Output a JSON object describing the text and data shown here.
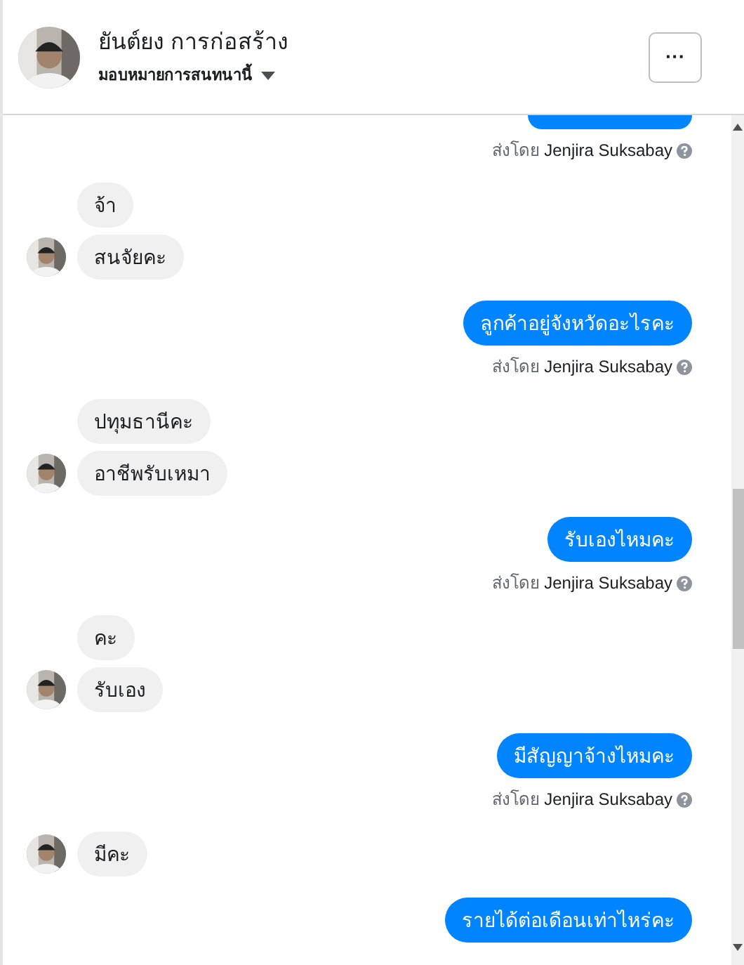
{
  "header": {
    "name": "ยันต์ยง การก่อสร้าง",
    "assign_label": "มอบหมายการสนทนานี้",
    "more_button": "···"
  },
  "messages": [
    {
      "kind": "outgoing_cut",
      "sent_by_label": "ส่งโดย",
      "sender": "Jenjira Suksabay"
    },
    {
      "kind": "incoming",
      "bubbles": [
        "จ้า",
        "สนจัยคะ"
      ]
    },
    {
      "kind": "outgoing",
      "text": "ลูกค้าอยู่จังหวัดอะไรคะ",
      "sent_by_label": "ส่งโดย",
      "sender": "Jenjira Suksabay"
    },
    {
      "kind": "incoming",
      "bubbles": [
        "ปทุมธานีคะ",
        "อาชีพรับเหมา"
      ]
    },
    {
      "kind": "outgoing",
      "text": "รับเองไหมคะ",
      "sent_by_label": "ส่งโดย",
      "sender": "Jenjira Suksabay"
    },
    {
      "kind": "incoming",
      "bubbles": [
        "คะ",
        "รับเอง"
      ]
    },
    {
      "kind": "outgoing",
      "text": "มีสัญญาจ้างไหมคะ",
      "sent_by_label": "ส่งโดย",
      "sender": "Jenjira Suksabay"
    },
    {
      "kind": "incoming",
      "bubbles": [
        "มีคะ"
      ]
    },
    {
      "kind": "outgoing",
      "text": "รายได้ต่อเดือนเท่าไหร่คะ"
    }
  ]
}
